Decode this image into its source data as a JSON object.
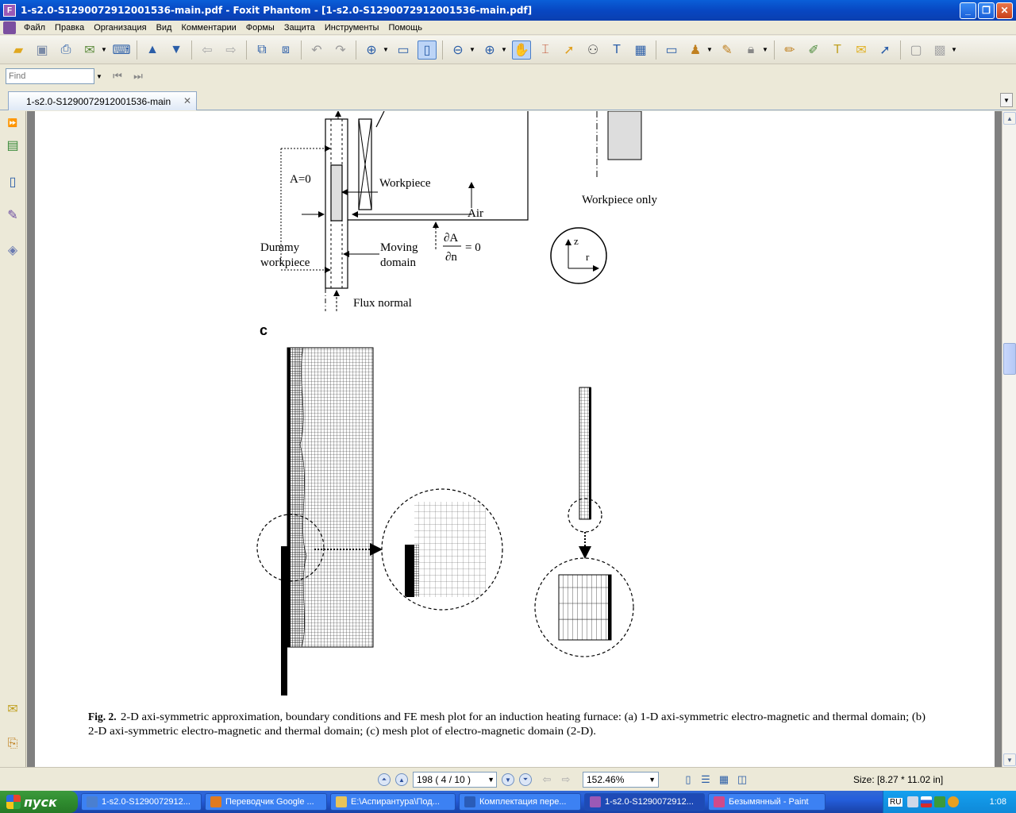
{
  "window": {
    "title": "1-s2.0-S1290072912001536-main.pdf - Foxit Phantom - [1-s2.0-S1290072912001536-main.pdf]",
    "minimize_glyph": "_",
    "restore_glyph": "❐",
    "close_glyph": "✕"
  },
  "menu": {
    "items": [
      "Файл",
      "Правка",
      "Организация",
      "Вид",
      "Комментарии",
      "Формы",
      "Защита",
      "Инструменты",
      "Помощь"
    ]
  },
  "find": {
    "placeholder": "Find"
  },
  "tab": {
    "label": "1-s2.0-S1290072912001536-main",
    "close_glyph": "✕"
  },
  "figure": {
    "labels": {
      "a0": "A=0",
      "workpiece": "Workpiece",
      "air": "Air",
      "dummy_line1": "Dummy",
      "dummy_line2": "workpiece",
      "moving_line1": "Moving",
      "moving_line2": "domain",
      "dA": "∂A",
      "dn": "∂n",
      "eq0": "= 0",
      "flux_normal": "Flux normal",
      "workpiece_only": "Workpiece only",
      "axis_z": "z",
      "axis_r": "r",
      "panel_c": "c"
    },
    "caption_bold": "Fig. 2.",
    "caption_line1": "2-D axi-symmetric approximation, boundary conditions and FE mesh plot for an induction heating furnace: (a) 1-D axi-symmetric electro-magnetic and thermal domain; (b)",
    "caption_line2": "2-D axi-symmetric electro-magnetic and thermal domain; (c) mesh plot of electro-magnetic domain (2-D)."
  },
  "status": {
    "page_display": "198  ( 4 / 10 )",
    "zoom": "152.46%",
    "size": "Size: [8.27 * 11.02 in]"
  },
  "taskbar": {
    "start": "пуск",
    "tasks": [
      {
        "label": "1-s2.0-S1290072912...",
        "color": "#4a7fd0"
      },
      {
        "label": "Переводчик Google ...",
        "color": "#e07a20"
      },
      {
        "label": "E:\\Аспирантура\\Под...",
        "color": "#e8c45a"
      },
      {
        "label": "Комплектация пере...",
        "color": "#2a5cb8"
      },
      {
        "label": "1-s2.0-S1290072912...",
        "color": "#9b59b6"
      },
      {
        "label": "Безымянный - Paint",
        "color": "#d04a8a"
      }
    ],
    "lang": "RU",
    "clock": "1:08"
  }
}
